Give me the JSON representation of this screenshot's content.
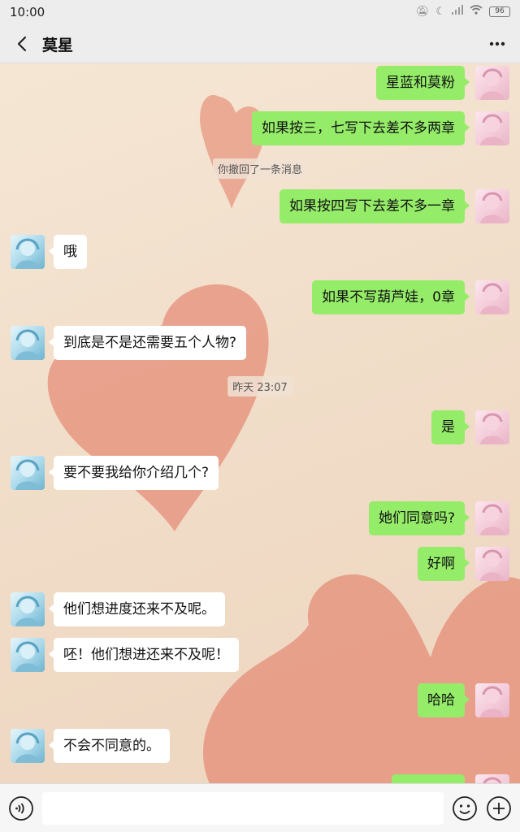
{
  "status_bar": {
    "time": "10:00",
    "battery": "96"
  },
  "header": {
    "title": "莫星"
  },
  "messages": [
    {
      "side": "me",
      "text": "星蓝和莫粉"
    },
    {
      "side": "me",
      "text": "如果按三，七写下去差不多两章"
    },
    {
      "side": "system",
      "text": "你撤回了一条消息"
    },
    {
      "side": "me",
      "text": "如果按四写下去差不多一章"
    },
    {
      "side": "other",
      "text": "哦"
    },
    {
      "side": "me",
      "text": "如果不写葫芦娃，0章"
    },
    {
      "side": "other",
      "text": "到底是不是还需要五个人物?"
    },
    {
      "side": "system",
      "text": "昨天 23:07"
    },
    {
      "side": "me",
      "text": "是"
    },
    {
      "side": "other",
      "text": "要不要我给你介绍几个?"
    },
    {
      "side": "me",
      "text": "她们同意吗?"
    },
    {
      "side": "me",
      "text": "好啊"
    },
    {
      "side": "other",
      "text": "他们想进度还来不及呢。"
    },
    {
      "side": "other",
      "text": "呸！他们想进还来不及呢！"
    },
    {
      "side": "me",
      "text": "哈哈"
    },
    {
      "side": "other",
      "text": "不会不同意的。"
    }
  ],
  "input": {
    "value": ""
  },
  "colors": {
    "me_bubble": "#95ec69",
    "other_bubble": "#ffffff",
    "heart": "#e5917b"
  },
  "icons": [
    "back-arrow-icon",
    "more-dots-icon",
    "voice-icon",
    "emoji-icon",
    "plus-icon",
    "signal-icon",
    "wifi-icon",
    "moon-icon"
  ]
}
